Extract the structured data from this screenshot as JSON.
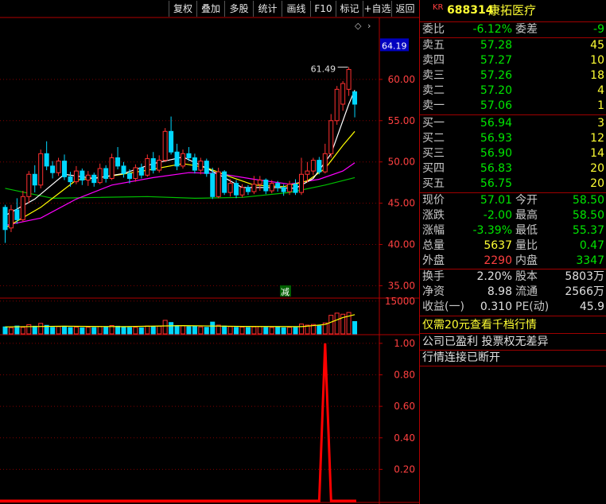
{
  "toolbar": {
    "buttons": [
      "复权",
      "叠加",
      "多股",
      "统计",
      "画线",
      "F10",
      "标记",
      "+自选",
      "返回"
    ]
  },
  "stock": {
    "market_badge": "KR",
    "code": "688314",
    "name": "康拓医疗"
  },
  "order_ratio": {
    "ratio_label": "委比",
    "ratio_value": "-6.12%",
    "diff_label": "委差",
    "diff_value": "-9"
  },
  "asks": [
    {
      "label": "卖五",
      "price": "57.28",
      "volume": "45"
    },
    {
      "label": "卖四",
      "price": "57.27",
      "volume": "10"
    },
    {
      "label": "卖三",
      "price": "57.26",
      "volume": "18"
    },
    {
      "label": "卖二",
      "price": "57.20",
      "volume": "4"
    },
    {
      "label": "卖一",
      "price": "57.06",
      "volume": "1"
    }
  ],
  "bids": [
    {
      "label": "买一",
      "price": "56.94",
      "volume": "3"
    },
    {
      "label": "买二",
      "price": "56.93",
      "volume": "12"
    },
    {
      "label": "买三",
      "price": "56.90",
      "volume": "14"
    },
    {
      "label": "买四",
      "price": "56.83",
      "volume": "20"
    },
    {
      "label": "买五",
      "price": "56.75",
      "volume": "20"
    }
  ],
  "stats": [
    {
      "l1": "现价",
      "v1": "57.01",
      "c1": "g",
      "l2": "今开",
      "v2": "58.50",
      "c2": "g"
    },
    {
      "l1": "涨跌",
      "v1": "-2.00",
      "c1": "g",
      "l2": "最高",
      "v2": "58.50",
      "c2": "g"
    },
    {
      "l1": "涨幅",
      "v1": "-3.39%",
      "c1": "g",
      "l2": "最低",
      "v2": "55.37",
      "c2": "g"
    },
    {
      "l1": "总量",
      "v1": "5637",
      "c1": "y",
      "l2": "量比",
      "v2": "0.47",
      "c2": "g"
    },
    {
      "l1": "外盘",
      "v1": "2290",
      "c1": "r",
      "l2": "内盘",
      "v2": "3347",
      "c2": "g"
    }
  ],
  "fundamentals": [
    {
      "l1": "换手",
      "v1": "2.20%",
      "l2": "股本",
      "v2": "5803万"
    },
    {
      "l1": "净资",
      "v1": "8.98",
      "l2": "流通",
      "v2": "2566万"
    },
    {
      "l1": "收益(一)",
      "v1": "0.310",
      "l2": "PE(动)",
      "v2": "45.9"
    }
  ],
  "messages": {
    "upgrade": "仅需20元查看千档行情",
    "company_notice": "公司已盈利 投票权无差异",
    "connection_status": "行情连接已断开"
  },
  "price_axis": {
    "current_price_tag": "64.19",
    "ticks": [
      "60.00",
      "55.00",
      "50.00",
      "45.00",
      "40.00",
      "35.00"
    ]
  },
  "volume_axis": {
    "ticks": [
      "15000"
    ]
  },
  "indicator_axis": {
    "ticks": [
      "1.00",
      "0.80",
      "0.60",
      "0.40",
      "0.20"
    ]
  },
  "annotations": {
    "high_label": "61.49",
    "reduce_marker": "减"
  },
  "colors": {
    "up": "#ff3030",
    "down": "#00d7ff",
    "ma5": "#ffffff",
    "ma10": "#ffff00",
    "ma20": "#ff00ff",
    "ma60": "#00c000",
    "indicator": "#ff0000",
    "grid": "#800000"
  },
  "chart_data": [
    {
      "type": "candlestick",
      "title": "",
      "ylim": [
        33.5,
        67.5
      ],
      "candles": [
        [
          44.5,
          41.8,
          44.8,
          40.2
        ],
        [
          42.0,
          44.2,
          44.8,
          41.5
        ],
        [
          44.2,
          43.0,
          45.6,
          42.5
        ],
        [
          43.0,
          45.8,
          46.5,
          42.8
        ],
        [
          45.8,
          48.5,
          48.9,
          45.0
        ],
        [
          48.5,
          47.2,
          49.6,
          46.3
        ],
        [
          47.2,
          51.0,
          51.5,
          46.8
        ],
        [
          51.0,
          49.5,
          52.5,
          49.0
        ],
        [
          49.5,
          48.7,
          50.1,
          48.0
        ],
        [
          48.7,
          50.1,
          50.5,
          48.3
        ],
        [
          50.1,
          48.2,
          50.9,
          47.8
        ],
        [
          48.2,
          47.6,
          48.8,
          47.0
        ],
        [
          47.6,
          48.9,
          49.5,
          47.3
        ],
        [
          48.9,
          47.8,
          49.2,
          47.2
        ],
        [
          47.8,
          48.4,
          48.9,
          47.1
        ],
        [
          48.4,
          47.5,
          48.7,
          47.0
        ],
        [
          47.5,
          49.2,
          49.8,
          47.3
        ],
        [
          49.2,
          48.0,
          49.6,
          47.5
        ],
        [
          48.0,
          50.5,
          51.0,
          47.8
        ],
        [
          50.5,
          49.5,
          51.8,
          49.1
        ],
        [
          49.5,
          48.6,
          50.0,
          48.1
        ],
        [
          48.6,
          48.0,
          49.1,
          47.4
        ],
        [
          48.0,
          49.3,
          49.7,
          47.6
        ],
        [
          49.3,
          48.4,
          49.8,
          48.0
        ],
        [
          48.4,
          50.4,
          50.9,
          48.2
        ],
        [
          50.4,
          49.0,
          51.2,
          48.6
        ],
        [
          49.0,
          50.2,
          50.8,
          48.7
        ],
        [
          50.2,
          53.7,
          54.1,
          50.0
        ],
        [
          53.7,
          51.2,
          55.5,
          50.9
        ],
        [
          51.2,
          49.5,
          52.2,
          49.0
        ],
        [
          49.5,
          51.0,
          51.5,
          49.2
        ],
        [
          51.0,
          50.5,
          51.8,
          50.1
        ],
        [
          50.5,
          49.0,
          51.0,
          48.6
        ],
        [
          49.0,
          50.1,
          50.5,
          48.5
        ],
        [
          50.1,
          48.6,
          50.4,
          48.2
        ],
        [
          48.6,
          45.8,
          49.3,
          45.5
        ],
        [
          45.8,
          48.8,
          49.3,
          45.6
        ],
        [
          48.8,
          46.3,
          49.0,
          46.0
        ],
        [
          46.3,
          47.4,
          47.9,
          45.8
        ],
        [
          47.4,
          46.0,
          47.8,
          45.6
        ],
        [
          46.0,
          46.9,
          47.3,
          45.7
        ],
        [
          46.9,
          46.4,
          47.2,
          46.0
        ],
        [
          46.4,
          47.3,
          48.3,
          46.1
        ],
        [
          47.3,
          47.8,
          48.3,
          46.5
        ],
        [
          47.8,
          46.5,
          48.0,
          46.1
        ],
        [
          46.5,
          47.4,
          47.8,
          46.2
        ],
        [
          47.4,
          46.9,
          47.7,
          46.4
        ],
        [
          46.9,
          46.4,
          47.3,
          45.9
        ],
        [
          46.4,
          47.3,
          47.7,
          46.0
        ],
        [
          47.3,
          46.3,
          47.9,
          46.0
        ],
        [
          46.3,
          48.5,
          50.5,
          46.0
        ],
        [
          48.5,
          48.9,
          50.0,
          47.5
        ],
        [
          48.9,
          50.2,
          50.5,
          48.4
        ],
        [
          50.2,
          48.8,
          50.6,
          48.5
        ],
        [
          48.8,
          51.0,
          52.2,
          48.6
        ],
        [
          51.0,
          55.0,
          55.8,
          50.5
        ],
        [
          55.0,
          58.8,
          59.2,
          54.5
        ],
        [
          57.0,
          59.5,
          59.8,
          56.2
        ],
        [
          58.8,
          61.2,
          61.49,
          58.0
        ],
        [
          58.5,
          57.0,
          58.5,
          55.4
        ]
      ],
      "ma5": [
        [
          0,
          43.5
        ],
        [
          5,
          45.5
        ],
        [
          10,
          48.5
        ],
        [
          15,
          48.0
        ],
        [
          20,
          48.6
        ],
        [
          25,
          49.8
        ],
        [
          30,
          50.6
        ],
        [
          33,
          49.6
        ],
        [
          36,
          48.5
        ],
        [
          40,
          46.9
        ],
        [
          45,
          46.9
        ],
        [
          49,
          46.8
        ],
        [
          52,
          48.0
        ],
        [
          55,
          51.0
        ],
        [
          58,
          57.0
        ],
        [
          59,
          58.7
        ]
      ],
      "ma10": [
        [
          0,
          42.0
        ],
        [
          6,
          44.5
        ],
        [
          12,
          47.8
        ],
        [
          18,
          48.3
        ],
        [
          24,
          49.0
        ],
        [
          30,
          49.8
        ],
        [
          34,
          49.3
        ],
        [
          38,
          48.2
        ],
        [
          42,
          47.2
        ],
        [
          47,
          47.0
        ],
        [
          51,
          47.7
        ],
        [
          54,
          49.2
        ],
        [
          57,
          52.0
        ],
        [
          59,
          53.7
        ]
      ],
      "ma20": [
        [
          0,
          42.3
        ],
        [
          6,
          43.2
        ],
        [
          12,
          45.5
        ],
        [
          18,
          47.2
        ],
        [
          25,
          48.1
        ],
        [
          31,
          48.7
        ],
        [
          36,
          48.6
        ],
        [
          42,
          47.9
        ],
        [
          48,
          47.3
        ],
        [
          53,
          47.9
        ],
        [
          57,
          48.9
        ],
        [
          59,
          49.9
        ]
      ],
      "ma60": [
        [
          0,
          46.8
        ],
        [
          8,
          45.6
        ],
        [
          16,
          45.7
        ],
        [
          24,
          45.8
        ],
        [
          32,
          45.6
        ],
        [
          40,
          45.7
        ],
        [
          48,
          46.3
        ],
        [
          54,
          47.2
        ],
        [
          59,
          48.1
        ]
      ]
    },
    {
      "type": "bar",
      "title": "volume",
      "ylim": [
        0,
        16000
      ],
      "values": [
        3200,
        2800,
        3600,
        3000,
        4200,
        3500,
        4800,
        3900,
        3000,
        3300,
        3500,
        2900,
        3100,
        2800,
        3000,
        2900,
        3400,
        3100,
        3800,
        3500,
        3300,
        2900,
        3000,
        2800,
        3600,
        3300,
        3500,
        6200,
        5200,
        3800,
        3700,
        3300,
        3600,
        3200,
        3000,
        5400,
        4000,
        3600,
        3300,
        3000,
        3100,
        2900,
        3200,
        3300,
        3000,
        2900,
        3100,
        2800,
        3000,
        2900,
        4500,
        4000,
        4300,
        3700,
        5000,
        8500,
        9500,
        9000,
        9800,
        5637
      ],
      "vol_ma": [
        [
          0,
          3200
        ],
        [
          10,
          3500
        ],
        [
          20,
          3300
        ],
        [
          30,
          3800
        ],
        [
          40,
          3400
        ],
        [
          50,
          3300
        ],
        [
          54,
          4300
        ],
        [
          57,
          7500
        ],
        [
          59,
          8800
        ]
      ]
    },
    {
      "type": "line",
      "title": "indicator",
      "ylim": [
        0,
        1.05
      ],
      "x": [
        0,
        52,
        53,
        54,
        55,
        56,
        59
      ],
      "y": [
        0,
        0,
        0,
        1.0,
        0,
        0,
        0
      ]
    }
  ]
}
